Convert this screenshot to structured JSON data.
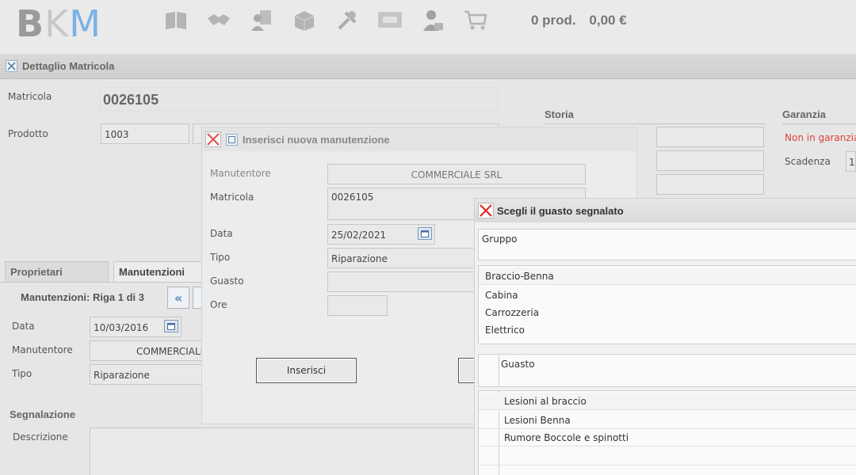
{
  "header": {
    "logo": {
      "b": "B",
      "k": "K",
      "m": "M"
    },
    "cart": {
      "products": "0 prod.",
      "total": "0,00 €"
    },
    "icons": [
      "book-icon",
      "handshake-icon",
      "document-user-icon",
      "box-icon",
      "tools-icon",
      "monitor-icon",
      "user-briefcase-icon",
      "cart-icon"
    ]
  },
  "main": {
    "title": "Dettaglio Matricola",
    "matricola_label": "Matricola",
    "matricola_value": "0026105",
    "prodotto_label": "Prodotto",
    "prodotto_value": "1003",
    "storia_title": "Storia",
    "garanzia_title": "Garanzia",
    "garanzia_status": "Non in garanzia",
    "scadenza_label": "Scadenza",
    "scadenza_value": "1",
    "tabs": [
      {
        "label": "Proprietari"
      },
      {
        "label": "Manutenzioni"
      }
    ],
    "pager_label": "Manutenzioni: Riga 1 di 3",
    "pager_first": "«",
    "data_label": "Data",
    "data_value": "10/03/2016",
    "manutentore_label": "Manutentore",
    "manutentore_value": "COMMERCIALI",
    "tipo_label": "Tipo",
    "tipo_value": "Riparazione",
    "segnalazione_title": "Segnalazione",
    "descrizione_label": "Descrizione"
  },
  "dialog_new": {
    "title": "Inserisci nuova manutenzione",
    "manutentore_label": "Manutentore",
    "manutentore_value": "COMMERCIALE SRL",
    "matricola_label": "Matricola",
    "matricola_value": "0026105",
    "data_label": "Data",
    "data_value": "25/02/2021",
    "tipo_label": "Tipo",
    "tipo_value": "Riparazione",
    "guasto_label": "Guasto",
    "ore_label": "Ore",
    "insert_label": "Inserisci"
  },
  "dialog_guasto": {
    "title": "Scegli il guasto segnalato",
    "gruppo_label": "Gruppo",
    "gruppi": [
      "Braccio-Benna",
      "Cabina",
      "Carrozzeria",
      "Elettrico"
    ],
    "guasto_label": "Guasto",
    "guasti": [
      "Lesioni al braccio",
      "Lesioni Benna",
      "Rumore Boccole e spinotti"
    ]
  },
  "colors": {
    "accent": "#7ab3e6",
    "warning": "#e0413a"
  }
}
